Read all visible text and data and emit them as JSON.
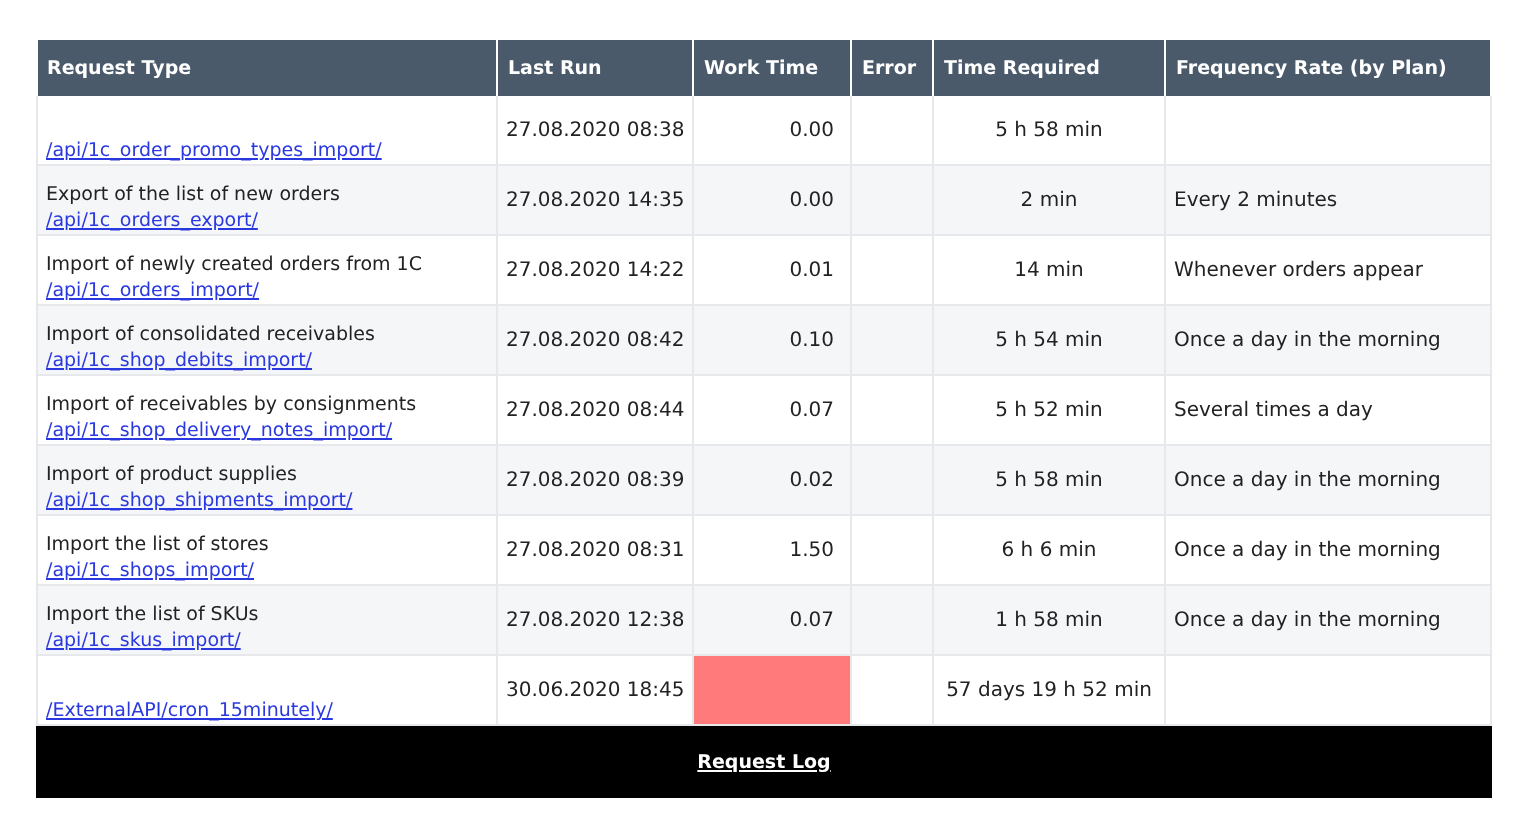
{
  "table": {
    "columns": [
      "Request Type",
      "Last Run",
      "Work Time",
      "Error",
      "Time Required",
      "Frequency Rate (by Plan)"
    ],
    "rows": [
      {
        "link": "/api/1c_order_promo_types_import/",
        "last_run": "27.08.2020 08:38",
        "work_time": "0.00",
        "error": false,
        "time_required": "5 h 58 min"
      },
      {
        "description": "Export of the list of new orders",
        "link": "/api/1c_orders_export/",
        "last_run": "27.08.2020 14:35",
        "work_time": "0.00",
        "error": false,
        "time_required": "2 min",
        "frequency": "Every 2 minutes"
      },
      {
        "description": "Import of newly created orders from 1C",
        "link": "/api/1c_orders_import/",
        "last_run": "27.08.2020 14:22",
        "work_time": "0.01",
        "error": false,
        "time_required": "14 min",
        "frequency": "Whenever orders appear"
      },
      {
        "description": "Import of consolidated receivables",
        "link": "/api/1c_shop_debits_import/",
        "last_run": "27.08.2020 08:42",
        "work_time": "0.10",
        "error": false,
        "time_required": "5 h 54 min",
        "frequency": "Once a day in the morning"
      },
      {
        "description": "Import of receivables by consignments",
        "link": "/api/1c_shop_delivery_notes_import/",
        "last_run": "27.08.2020 08:44",
        "work_time": "0.07",
        "error": false,
        "time_required": "5 h 52 min",
        "frequency": "Several times a day"
      },
      {
        "description": "Import of product supplies",
        "link": "/api/1c_shop_shipments_import/",
        "last_run": "27.08.2020 08:39",
        "work_time": "0.02",
        "error": false,
        "time_required": "5 h 58 min",
        "frequency": "Once a day in the morning"
      },
      {
        "description": "Import the list of stores",
        "link": "/api/1c_shops_import/",
        "last_run": "27.08.2020 08:31",
        "work_time": "1.50",
        "error": false,
        "time_required": "6 h 6 min",
        "frequency": "Once a day in the morning"
      },
      {
        "description": "Import the list of SKUs",
        "link": "/api/1c_skus_import/",
        "last_run": "27.08.2020 12:38",
        "work_time": "0.07",
        "error": false,
        "time_required": "1 h 58 min",
        "frequency": "Once a day in the morning"
      },
      {
        "link": "/ExternalAPI/cron_15minutely/",
        "last_run": "30.06.2020 18:45",
        "error": true,
        "time_required": "57 days 19 h 52 min"
      }
    ]
  },
  "footer": {
    "link": "Request Log"
  }
}
